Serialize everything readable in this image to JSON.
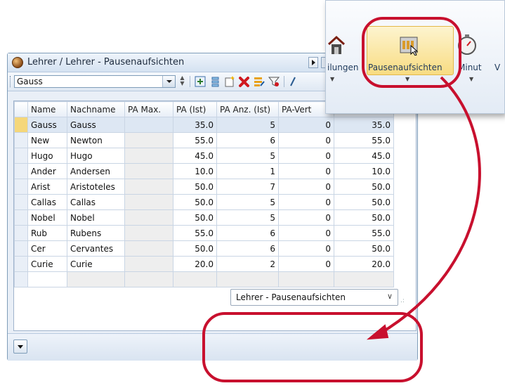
{
  "window": {
    "title": "Lehrer / Lehrer - Pausenaufsichten"
  },
  "toolbar": {
    "selector_value": "Gauss",
    "icons": [
      "add-row-icon",
      "list-icon",
      "new-entry-icon",
      "delete-icon",
      "edit-icon",
      "filter-icon",
      "more-icon"
    ]
  },
  "grid": {
    "columns": [
      "Name",
      "Nachname",
      "PA Max.",
      "PA (Ist)",
      "PA Anz. (Ist)",
      "PA-Vert",
      ""
    ],
    "rows": [
      [
        "Gauss",
        "Gauss",
        "",
        "35.0",
        "5",
        "0",
        "35.0"
      ],
      [
        "New",
        "Newton",
        "",
        "55.0",
        "6",
        "0",
        "55.0"
      ],
      [
        "Hugo",
        "Hugo",
        "",
        "45.0",
        "5",
        "0",
        "45.0"
      ],
      [
        "Ander",
        "Andersen",
        "",
        "10.0",
        "1",
        "0",
        "10.0"
      ],
      [
        "Arist",
        "Aristoteles",
        "",
        "50.0",
        "7",
        "0",
        "50.0"
      ],
      [
        "Callas",
        "Callas",
        "",
        "50.0",
        "5",
        "0",
        "50.0"
      ],
      [
        "Nobel",
        "Nobel",
        "",
        "50.0",
        "5",
        "0",
        "50.0"
      ],
      [
        "Rub",
        "Rubens",
        "",
        "55.0",
        "6",
        "0",
        "55.0"
      ],
      [
        "Cer",
        "Cervantes",
        "",
        "50.0",
        "6",
        "0",
        "50.0"
      ],
      [
        "Curie",
        "Curie",
        "",
        "20.0",
        "2",
        "0",
        "20.0"
      ]
    ],
    "selected_row_index": 0
  },
  "bottom": {
    "view_select_value": "Lehrer - Pausenaufsichten"
  },
  "ribbon": {
    "left_label": "ilungen",
    "main_label": "Pausenaufsichten",
    "right_label": "Minut",
    "far_right_label": "V"
  },
  "colors": {
    "annotation_red": "#c8102e",
    "selection_yellow": "#f5d77a",
    "ribbon_highlight": "#f8dc82"
  }
}
